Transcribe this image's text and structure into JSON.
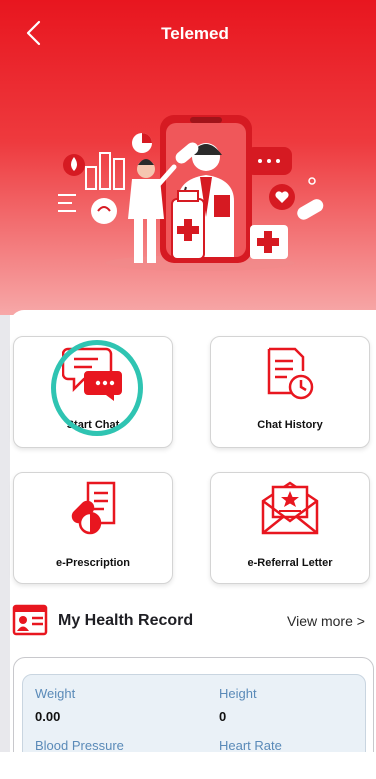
{
  "header": {
    "title": "Telemed",
    "back_icon": "chevron-left-icon",
    "background": "#e8161f"
  },
  "services": [
    {
      "label": "Start Chat",
      "icon": "chat-bubbles-icon"
    },
    {
      "label": "Chat History",
      "icon": "document-clock-icon"
    },
    {
      "label": "e-Prescription",
      "icon": "prescription-pill-icon"
    },
    {
      "label": "e-Referral Letter",
      "icon": "envelope-star-letter-icon"
    }
  ],
  "health_record": {
    "title": "My Health Record",
    "icon": "id-card-icon",
    "view_more": "View more >",
    "fields": [
      {
        "label": "Weight",
        "value": "0.00"
      },
      {
        "label": "Height",
        "value": "0"
      },
      {
        "label": "Blood Pressure",
        "value": ""
      },
      {
        "label": "Heart Rate",
        "value": ""
      }
    ]
  },
  "colors": {
    "brand_red": "#e8161f",
    "highlight": "#2fc4b2",
    "record_label": "#5a8ab8"
  }
}
